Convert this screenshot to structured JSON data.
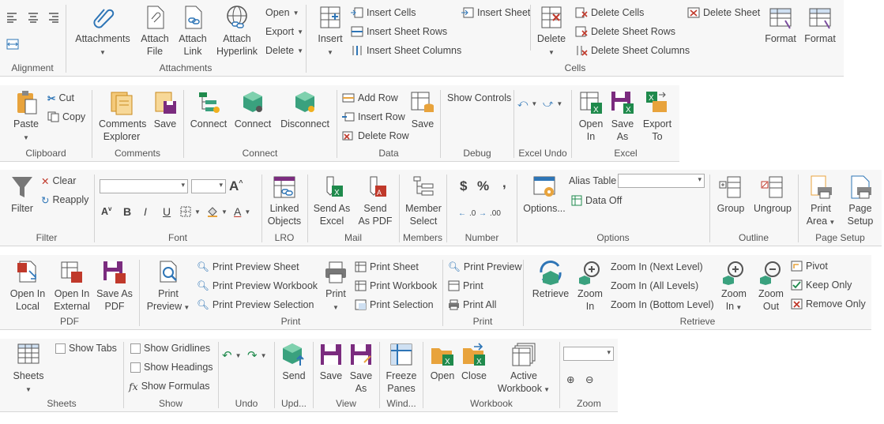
{
  "colors": {
    "blue": "#2e75b6",
    "red": "#c0392b",
    "green": "#1f8a4c",
    "teal": "#3aa17e",
    "orange": "#e8a33c",
    "purple": "#7b2c7f",
    "gray": "#666666"
  },
  "row1": {
    "alignment": {
      "label": "Alignment"
    },
    "attachments": {
      "label": "Attachments",
      "attachments": "Attachments",
      "attach_file": [
        "Attach",
        "File"
      ],
      "attach_link": [
        "Attach",
        "Link"
      ],
      "attach_hyperlink": [
        "Attach",
        "Hyperlink"
      ],
      "open": "Open",
      "export": "Export",
      "delete": "Delete"
    },
    "cells": {
      "label": "Cells",
      "insert": "Insert",
      "insert_cells": "Insert Cells",
      "insert_sheet_rows": "Insert Sheet Rows",
      "insert_sheet_columns": "Insert Sheet Columns",
      "insert_sheet": "Insert Sheet",
      "delete": "Delete",
      "delete_cells": "Delete Cells",
      "delete_sheet_rows": "Delete Sheet Rows",
      "delete_sheet_columns": "Delete Sheet Columns",
      "delete_sheet": "Delete Sheet",
      "format1": "Format",
      "format2": "Format"
    }
  },
  "row2": {
    "clipboard": {
      "label": "Clipboard",
      "paste": "Paste",
      "cut": "Cut",
      "copy": "Copy"
    },
    "comments": {
      "label": "Comments",
      "explorer": [
        "Comments",
        "Explorer"
      ],
      "save": "Save"
    },
    "connect": {
      "label": "Connect",
      "connect1": "Connect",
      "connect2": "Connect",
      "disconnect": "Disconnect"
    },
    "data": {
      "label": "Data",
      "add_row": "Add Row",
      "insert_row": "Insert Row",
      "delete_row": "Delete Row",
      "save": "Save"
    },
    "debug": {
      "label": "Debug",
      "show_controls": "Show Controls"
    },
    "excel_undo": {
      "label": "Excel Undo"
    },
    "excel": {
      "label": "Excel",
      "open_in": [
        "Open",
        "In"
      ],
      "save_as": [
        "Save",
        "As"
      ],
      "export_to": [
        "Export",
        "To"
      ]
    }
  },
  "row3": {
    "filter": {
      "label": "Filter",
      "filter": "Filter",
      "clear": "Clear",
      "reapply": "Reapply"
    },
    "font": {
      "label": "Font",
      "b": "B",
      "i": "I",
      "u": "U"
    },
    "lro": {
      "label": "LRO",
      "linked": [
        "Linked",
        "Objects"
      ]
    },
    "mail": {
      "label": "Mail",
      "send_excel": [
        "Send As",
        "Excel"
      ],
      "send_pdf": [
        "Send",
        "As PDF"
      ]
    },
    "members": {
      "label": "Members",
      "member_select": [
        "Member",
        "Select"
      ]
    },
    "number": {
      "label": "Number",
      "dollar": "$",
      "percent": "%",
      "comma": ",",
      "inc": ".0",
      "dec": ".00"
    },
    "options": {
      "label": "Options",
      "options": "Options...",
      "alias_table": "Alias Table",
      "data_off": "Data Off"
    },
    "outline": {
      "label": "Outline",
      "group": "Group",
      "ungroup": "Ungroup"
    },
    "page_setup": {
      "label": "Page Setup",
      "print_area": [
        "Print",
        "Area"
      ],
      "page_setup": [
        "Page",
        "Setup"
      ]
    }
  },
  "row4": {
    "pdf": {
      "label": "PDF",
      "open_local": [
        "Open In",
        "Local"
      ],
      "open_external": [
        "Open In",
        "External"
      ],
      "save_pdf": [
        "Save As",
        "PDF"
      ]
    },
    "print": {
      "label": "Print",
      "print_preview": [
        "Print",
        "Preview"
      ],
      "pp_sheet": "Print Preview Sheet",
      "pp_workbook": "Print Preview Workbook",
      "pp_selection": "Print Preview Selection",
      "print": "Print",
      "print_sheet": "Print Sheet",
      "print_workbook": "Print Workbook",
      "print_selection": "Print Selection"
    },
    "print2": {
      "label": "Print",
      "print_preview": "Print Preview",
      "print": "Print",
      "print_all": "Print All"
    },
    "retrieve": {
      "label": "Retrieve",
      "retrieve": "Retrieve",
      "zoom_in": [
        "Zoom",
        "In"
      ],
      "zoom_next": "Zoom In (Next Level)",
      "zoom_all": "Zoom In (All Levels)",
      "zoom_bottom": "Zoom In (Bottom Level)",
      "zoom_in2": [
        "Zoom",
        "In"
      ],
      "zoom_out": [
        "Zoom",
        "Out"
      ],
      "pivot": "Pivot",
      "keep_only": "Keep Only",
      "remove_only": "Remove Only"
    }
  },
  "row5": {
    "sheets": {
      "label": "Sheets",
      "sheets": "Sheets",
      "show_tabs": "Show Tabs"
    },
    "show": {
      "label": "Show",
      "gridlines": "Show Gridlines",
      "headings": "Show Headings",
      "formulas": "Show Formulas"
    },
    "undo": {
      "label": "Undo"
    },
    "upd": {
      "label": "Upd...",
      "send": "Send"
    },
    "view": {
      "label": "View",
      "save": "Save",
      "save_as": [
        "Save",
        "As"
      ]
    },
    "wind": {
      "label": "Wind...",
      "freeze": [
        "Freeze",
        "Panes"
      ]
    },
    "workbook": {
      "label": "Workbook",
      "open": "Open",
      "close": "Close",
      "active": [
        "Active",
        "Workbook"
      ]
    },
    "zoom": {
      "label": "Zoom"
    }
  }
}
